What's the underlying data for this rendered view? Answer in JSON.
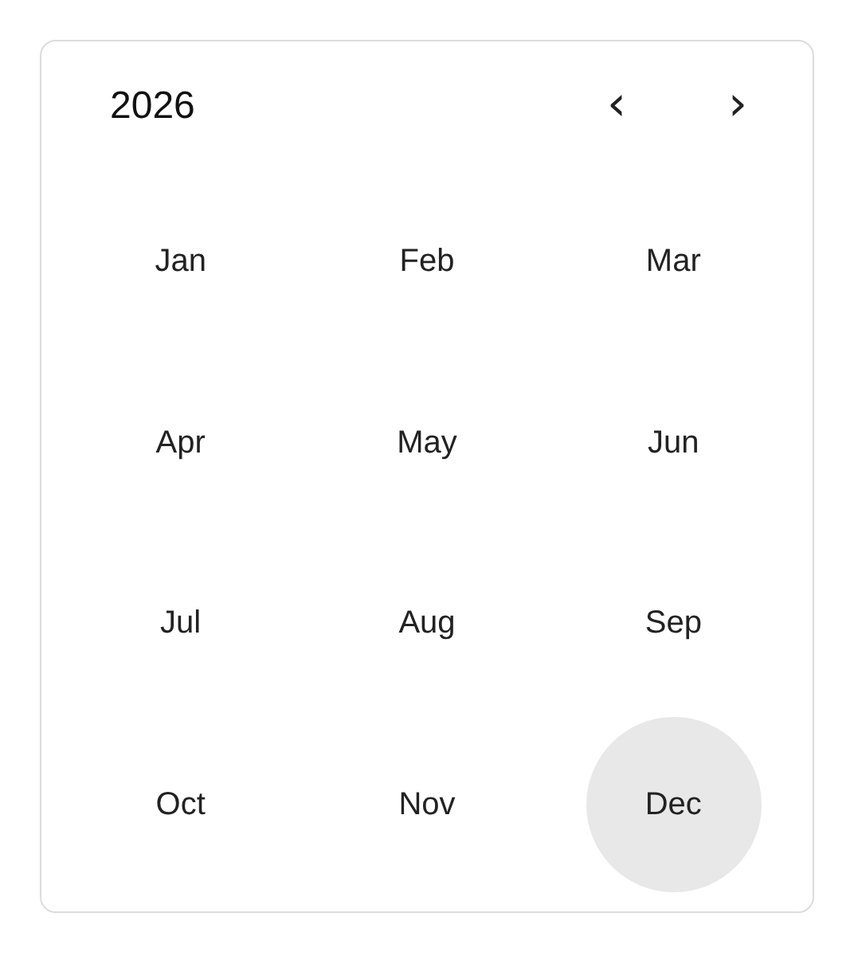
{
  "header": {
    "year": "2026",
    "prev": "‹",
    "next": "›"
  },
  "months": [
    {
      "label": "Jan",
      "selected": false
    },
    {
      "label": "Feb",
      "selected": false
    },
    {
      "label": "Mar",
      "selected": false
    },
    {
      "label": "Apr",
      "selected": false
    },
    {
      "label": "May",
      "selected": false
    },
    {
      "label": "Jun",
      "selected": false
    },
    {
      "label": "Jul",
      "selected": false
    },
    {
      "label": "Aug",
      "selected": false
    },
    {
      "label": "Sep",
      "selected": false
    },
    {
      "label": "Oct",
      "selected": false
    },
    {
      "label": "Nov",
      "selected": false
    },
    {
      "label": "Dec",
      "selected": true
    }
  ]
}
